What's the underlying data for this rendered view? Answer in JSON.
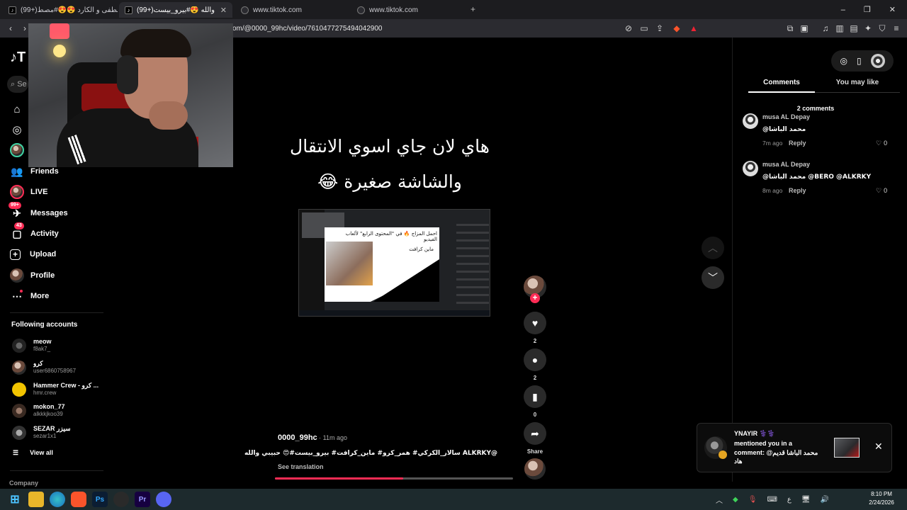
{
  "browser": {
    "tabs": [
      {
        "label": "(99+)مصطفى و الكارد 😍😍#مصط..."
      },
      {
        "label": "(99+)حبيبي والله 😍#بيرو_بيست #..."
      },
      {
        "label": "www.tiktok.com"
      },
      {
        "label": "www.tiktok.com"
      }
    ],
    "url": "om/@0000_99hc/video/7610477275494042900",
    "new_tab": "+",
    "close": "✕"
  },
  "sidebar": {
    "logo": "♪T",
    "search_placeholder": "Se",
    "items": [
      {
        "label": "Friends",
        "icon": "friends-icon"
      },
      {
        "label": "LIVE",
        "icon": "live-icon"
      },
      {
        "label": "Messages",
        "icon": "messages-icon",
        "badge": "99+"
      },
      {
        "label": "Activity",
        "icon": "activity-icon",
        "badge": "43"
      },
      {
        "label": "Upload",
        "icon": "upload-icon"
      },
      {
        "label": "Profile",
        "icon": "profile-icon"
      },
      {
        "label": "More",
        "icon": "more-icon"
      }
    ],
    "following_title": "Following accounts",
    "accounts": [
      {
        "name": "meow",
        "handle": "f8ak7_"
      },
      {
        "name": "كرو",
        "handle": "user6860758967"
      },
      {
        "name": "Hammer Crew - كرو ...",
        "handle": "hmr.crew"
      },
      {
        "name": "mokon_77",
        "handle": "alkkkjkoo39"
      },
      {
        "name": "SEZAR سيزر",
        "handle": "sezar1x1"
      }
    ],
    "view_all": "View all",
    "company": "Company"
  },
  "video": {
    "caption_line1": "هاي لان جاي اسوي الانتقال",
    "caption_line2": "والشاشة صغيرة 😂",
    "inner_text1": "احمل المزاج 🔥 في \"المحتوى الرابع\" لألعاب الفيديو",
    "inner_text2": "ماين كرافت",
    "author": "0000_99hc",
    "time": " · 11m ago",
    "description": "@ALKRKY سالار_الكركي# همر_كرو# ماين_كرافت# بيرو_بيست#😍 حبيبي والله",
    "see_translation": "See translation",
    "progress": 0.54
  },
  "actions": {
    "likes": "2",
    "comments": "2",
    "saves": "0",
    "share": "Share"
  },
  "comments_panel": {
    "tab_comments": "Comments",
    "tab_like": "You may like",
    "count": "2 comments",
    "comments": [
      {
        "user": "musa AL Depay",
        "text": "@محمد الباشا",
        "time": "7m ago",
        "reply": "Reply",
        "likes": "0"
      },
      {
        "user": "musa AL Depay",
        "text": "@محمد الباشا @BERO @ALKRKY",
        "time": "8m ago",
        "reply": "Reply",
        "likes": "0"
      }
    ]
  },
  "toast": {
    "title": "YNAYIR ⚕️⚕️",
    "body": "mentioned you in a comment: @محمد الباشا قديم هاد",
    "close": "✕"
  },
  "taskbar": {
    "time": "8:10 PM",
    "date": "2/24/2026",
    "lang": "ع"
  },
  "colors": {
    "accent": "#fe2c55",
    "background": "#000000"
  }
}
